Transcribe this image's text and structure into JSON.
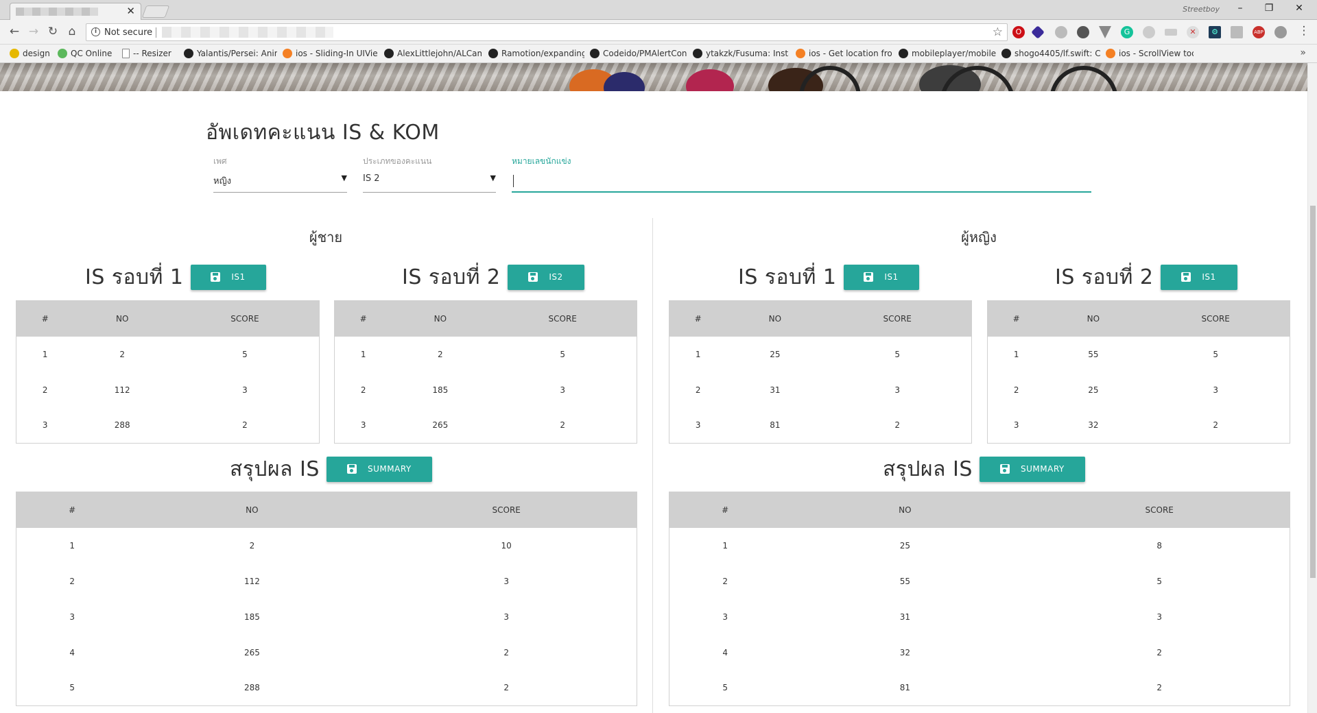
{
  "browser": {
    "profile_name": "Streetboy",
    "omnibox_security": "Not secure",
    "bookmarks": [
      {
        "label": "design",
        "color": "#e6b800"
      },
      {
        "label": "QC Online",
        "color": "#5cb85c"
      },
      {
        "label": "-- Resizer",
        "color": "#ffffff"
      },
      {
        "label": "Yalantis/Persei: Anim",
        "color": "#222222"
      },
      {
        "label": "ios - Sliding-In UIVie",
        "color": "#f48024"
      },
      {
        "label": "AlexLittlejohn/ALCam",
        "color": "#222222"
      },
      {
        "label": "Ramotion/expanding",
        "color": "#222222"
      },
      {
        "label": "Codeido/PMAlertCon",
        "color": "#222222"
      },
      {
        "label": "ytakzk/Fusuma: Insta",
        "color": "#222222"
      },
      {
        "label": "ios - Get location fro",
        "color": "#f48024"
      },
      {
        "label": "mobileplayer/mobile",
        "color": "#222222"
      },
      {
        "label": "shogo4405/lf.swift: C",
        "color": "#222222"
      },
      {
        "label": "ios - ScrollView too s",
        "color": "#f48024"
      }
    ],
    "bookmarks_more": "»"
  },
  "page": {
    "title": "อัพเดทคะแนน IS & KOM",
    "filters": {
      "gender_label": "เพศ",
      "gender_value": "หญิง",
      "score_type_label": "ประเภทของคะแนน",
      "score_type_value": "IS 2",
      "racer_number_label": "หมายเลขนักแข่ง",
      "racer_number_value": ""
    },
    "columns": {
      "index": "#",
      "no": "NO",
      "score": "SCORE"
    },
    "men": {
      "heading": "ผู้ชาย",
      "round1": {
        "title": "IS รอบที่ 1",
        "button": "IS1",
        "rows": [
          [
            "1",
            "2",
            "5"
          ],
          [
            "2",
            "112",
            "3"
          ],
          [
            "3",
            "288",
            "2"
          ]
        ]
      },
      "round2": {
        "title": "IS รอบที่ 2",
        "button": "IS2",
        "rows": [
          [
            "1",
            "2",
            "5"
          ],
          [
            "2",
            "185",
            "3"
          ],
          [
            "3",
            "265",
            "2"
          ]
        ]
      },
      "summary": {
        "title": "สรุปผล IS",
        "button": "SUMMARY",
        "rows": [
          [
            "1",
            "2",
            "10"
          ],
          [
            "2",
            "112",
            "3"
          ],
          [
            "3",
            "185",
            "3"
          ],
          [
            "4",
            "265",
            "2"
          ],
          [
            "5",
            "288",
            "2"
          ]
        ]
      }
    },
    "women": {
      "heading": "ผู้หญิง",
      "round1": {
        "title": "IS รอบที่ 1",
        "button": "IS1",
        "rows": [
          [
            "1",
            "25",
            "5"
          ],
          [
            "2",
            "31",
            "3"
          ],
          [
            "3",
            "81",
            "2"
          ]
        ]
      },
      "round2": {
        "title": "IS รอบที่ 2",
        "button": "IS1",
        "rows": [
          [
            "1",
            "55",
            "5"
          ],
          [
            "2",
            "25",
            "3"
          ],
          [
            "3",
            "32",
            "2"
          ]
        ]
      },
      "summary": {
        "title": "สรุปผล IS",
        "button": "SUMMARY",
        "rows": [
          [
            "1",
            "25",
            "8"
          ],
          [
            "2",
            "55",
            "5"
          ],
          [
            "3",
            "31",
            "3"
          ],
          [
            "4",
            "32",
            "2"
          ],
          [
            "5",
            "81",
            "2"
          ]
        ]
      }
    }
  },
  "colors": {
    "accent": "#26a69a",
    "table_header": "#d0d0d0"
  }
}
